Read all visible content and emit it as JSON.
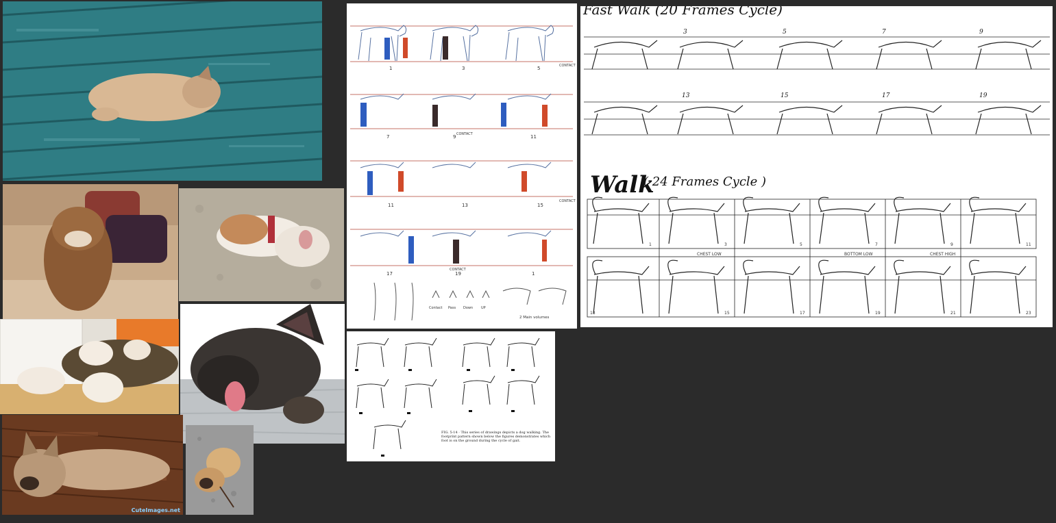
{
  "board": {
    "background": "#2b2b2b"
  },
  "photos": [
    {
      "name": "teal-deck-frenchie"
    },
    {
      "name": "couch-bulldog"
    },
    {
      "name": "carpet-bulldog"
    },
    {
      "name": "puppies-bed"
    },
    {
      "name": "brindle-frenchie-tongue"
    },
    {
      "name": "wood-floor-frenchie",
      "watermark": "CuteImages.net"
    },
    {
      "name": "pug-floor"
    }
  ],
  "color_walk_sheet": {
    "frame_numbers": [
      "1",
      "3",
      "5",
      "7",
      "9",
      "11",
      "11",
      "13",
      "15",
      "17",
      "19",
      "1"
    ],
    "contact_labels": [
      "CONTACT",
      "CONTACT",
      "CONTACT",
      "CONTACT"
    ],
    "legend": [
      "Contact",
      "Pass",
      "Down",
      "UP"
    ],
    "footer": "2 Main volumes"
  },
  "boxer_sheet": {
    "caption": "FIG. 5-14 · This series of drawings depicts a dog walking. The footprint pattern shown below the figures demonstrates which foot is on the ground during the cycle of gait."
  },
  "wolf_sheet": {
    "top_title": "Fast Walk (20 Frames Cycle)",
    "top_frames": [
      "3",
      "5",
      "7",
      "9",
      "13",
      "15",
      "17",
      "19"
    ],
    "walk_title": "Walk",
    "walk_subtitle": "( 24 Frames Cycle )",
    "bottom_frames_row1": [
      "1",
      "3",
      "5",
      "7",
      "9",
      "11"
    ],
    "bottom_labels": [
      "CHEST LOW",
      "BOTTOM LOW",
      "CHEST HIGH"
    ],
    "bottom_frames_row2": [
      "13",
      "15",
      "17",
      "19",
      "21",
      "23"
    ]
  }
}
